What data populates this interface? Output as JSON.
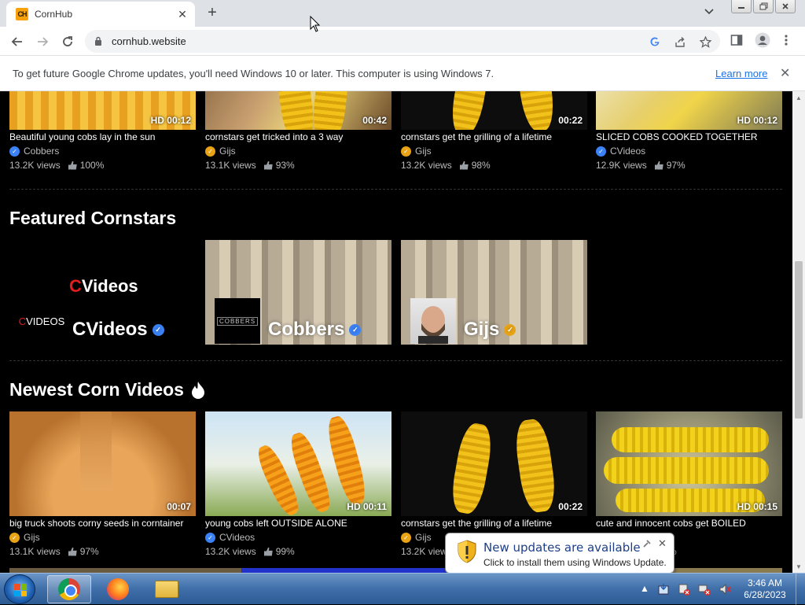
{
  "browser": {
    "tab_title": "CornHub",
    "favicon_text": "CH",
    "url": "cornhub.website",
    "infobar": {
      "message": "To get future Google Chrome updates, you'll need Windows 10 or later. This computer is using Windows 7.",
      "link": "Learn more"
    }
  },
  "top_videos": [
    {
      "title": "Beautiful young cobs lay in the sun",
      "channel": "Cobbers",
      "badge": "blue",
      "views": "13.2K views",
      "rating": "100%",
      "duration": "HD 00:12"
    },
    {
      "title": "cornstars get tricked into a 3 way",
      "channel": "Gijs",
      "badge": "gold",
      "views": "13.1K views",
      "rating": "93%",
      "duration": "00:42"
    },
    {
      "title": "cornstars get the grilling of a lifetime",
      "channel": "Gijs",
      "badge": "gold",
      "views": "13.2K views",
      "rating": "98%",
      "duration": "00:22"
    },
    {
      "title": "SLICED COBS COOKED TOGETHER",
      "channel": "CVideos",
      "badge": "blue",
      "views": "12.9K views",
      "rating": "97%",
      "duration": "HD 00:12"
    }
  ],
  "featured": {
    "heading": "Featured Cornstars",
    "stars": [
      {
        "name": "CVideos",
        "logo_first": "C",
        "logo_rest": "Videos",
        "avatar_first": "C",
        "avatar_rest": "VIDEOS",
        "badge": "blue"
      },
      {
        "name": "Cobbers",
        "avatar_text": "COBBERS",
        "badge": "blue"
      },
      {
        "name": "Gijs",
        "badge": "gold"
      }
    ]
  },
  "newest": {
    "heading": "Newest Corn Videos",
    "videos": [
      {
        "title": "big truck shoots corny seeds in corntainer",
        "channel": "Gijs",
        "badge": "gold",
        "views": "13.1K views",
        "rating": "97%",
        "duration": "00:07"
      },
      {
        "title": "young cobs left OUTSIDE ALONE",
        "channel": "CVideos",
        "badge": "blue",
        "views": "13.2K views",
        "rating": "99%",
        "duration": "HD 00:11"
      },
      {
        "title": "cornstars get the grilling of a lifetime",
        "channel": "Gijs",
        "badge": "gold",
        "views": "13.2K views",
        "rating": "",
        "duration": "00:22"
      },
      {
        "title": "cute and innocent cobs get BOILED",
        "channel": "",
        "badge": "",
        "views": "",
        "rating": "%",
        "duration": "HD 00:15"
      }
    ]
  },
  "notification": {
    "title": "New updates are available",
    "text": "Click to install them using Windows Update."
  },
  "taskbar": {
    "time": "3:46 AM",
    "date": "6/28/2023"
  },
  "icons": {
    "badge_check": "✓",
    "close": "✕",
    "new_tab": "+"
  },
  "colors": {
    "badge_blue": "#3b82f6",
    "badge_gold": "#e8a317",
    "link": "#1a73e8",
    "logo_red": "#e11d1d"
  }
}
